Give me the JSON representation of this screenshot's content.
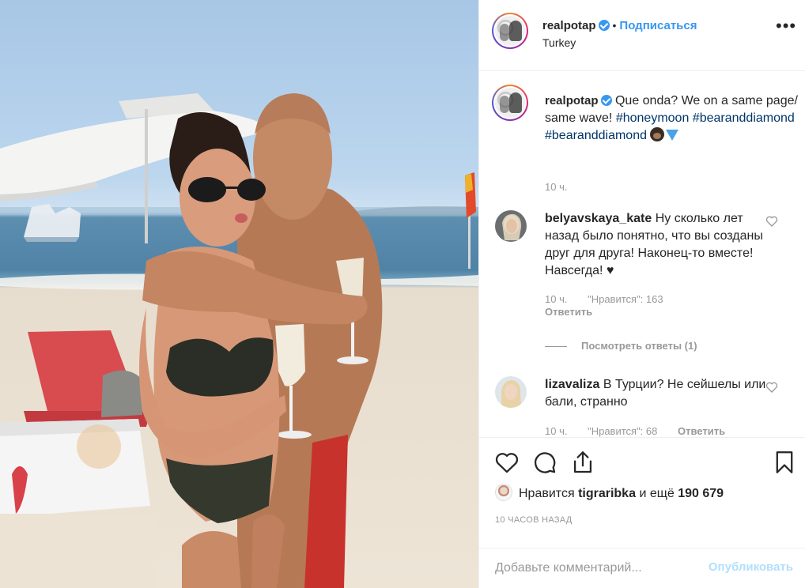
{
  "post": {
    "author": "realpotap",
    "follow_label": "Подписаться",
    "location": "Turkey",
    "more_label": "•••",
    "caption_parts": {
      "text": "Que onda? We on a same page/ same wave!",
      "tag1": "#honeymoon",
      "tag2": "#bearanddiamond",
      "tag3": "#bearanddiamond"
    },
    "caption_time": "10 ч."
  },
  "comments": [
    {
      "user": "belyavskaya_kate",
      "text": "Ну сколько лет назад было понятно, что вы созданы друг для друга! Наконец-то вместе! Навсегда! ♥",
      "time": "10 ч.",
      "likes": "\"Нравится\": 163",
      "reply": "Ответить",
      "view_replies": "Посмотреть ответы (1)"
    },
    {
      "user": "lizavaliza",
      "text": "В Турции? Не сейшелы или бали, странно",
      "time": "10 ч.",
      "likes": "\"Нравится\": 68",
      "reply": "Ответить"
    }
  ],
  "likes_line": {
    "prefix": "Нравится",
    "user": "tigraribka",
    "middle": "и ещё",
    "count": "190 679"
  },
  "posted_ago": "10 ЧАСОВ НАЗАД",
  "comment_box": {
    "placeholder": "Добавьте комментарий...",
    "publish_label": "Опубликовать"
  },
  "colors": {
    "accent": "#3897f0",
    "hashtag": "#003569",
    "publish_disabled": "#b2dffc"
  }
}
